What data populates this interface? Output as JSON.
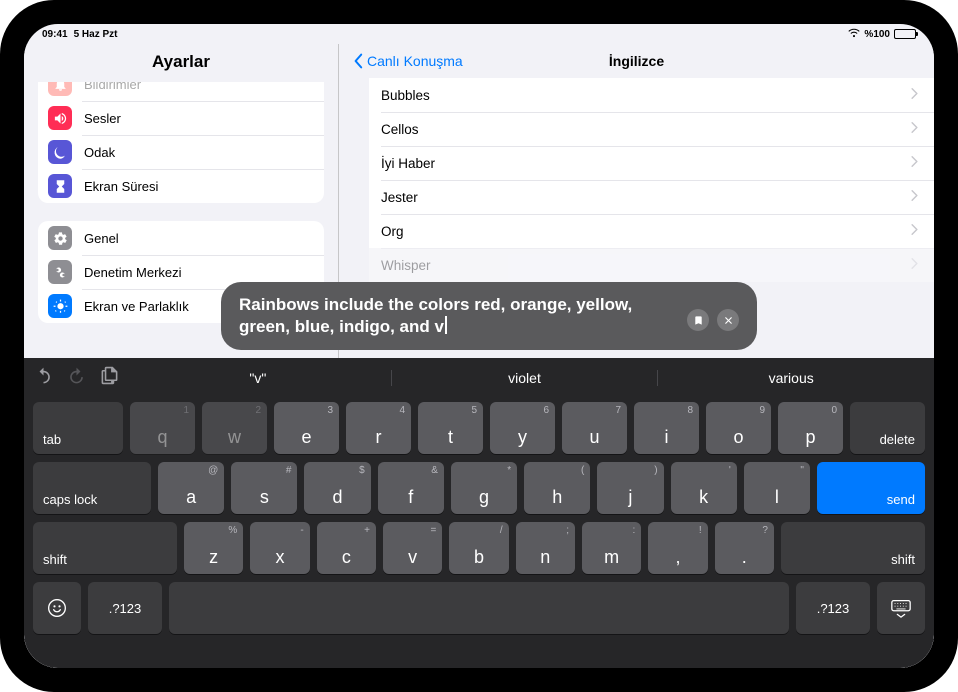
{
  "status": {
    "time": "09:41",
    "date": "5 Haz Pzt",
    "battery": "%100"
  },
  "sidebar": {
    "title": "Ayarlar",
    "group1": [
      {
        "label": "Bildirimler",
        "icon": "bell",
        "color": "#ff3b30"
      },
      {
        "label": "Sesler",
        "icon": "speaker",
        "color": "#ff2d55"
      },
      {
        "label": "Odak",
        "icon": "moon",
        "color": "#5856d6"
      },
      {
        "label": "Ekran Süresi",
        "icon": "hourglass",
        "color": "#5856d6"
      }
    ],
    "group2": [
      {
        "label": "Genel",
        "icon": "gear",
        "color": "#8e8e93"
      },
      {
        "label": "Denetim Merkezi",
        "icon": "switches",
        "color": "#8e8e93"
      },
      {
        "label": "Ekran ve Parlaklık",
        "icon": "brightness",
        "color": "#007aff"
      }
    ]
  },
  "detail": {
    "back_label": "Canlı Konuşma",
    "title": "İngilizce",
    "voices": [
      "Bubbles",
      "Cellos",
      "İyi Haber",
      "Jester",
      "Org",
      "Whisper"
    ]
  },
  "live_speech": {
    "text": "Rainbows include the colors red, orange, yellow, green, blue, indigo, and v"
  },
  "keyboard": {
    "predictions": [
      "\"v\"",
      "violet",
      "various"
    ],
    "row1": [
      {
        "k": "q",
        "s": "1"
      },
      {
        "k": "w",
        "s": "2"
      },
      {
        "k": "e",
        "s": "3"
      },
      {
        "k": "r",
        "s": "4"
      },
      {
        "k": "t",
        "s": "5"
      },
      {
        "k": "y",
        "s": "6"
      },
      {
        "k": "u",
        "s": "7"
      },
      {
        "k": "i",
        "s": "8"
      },
      {
        "k": "o",
        "s": "9"
      },
      {
        "k": "p",
        "s": "0"
      }
    ],
    "row2": [
      {
        "k": "a",
        "s": "@"
      },
      {
        "k": "s",
        "s": "#"
      },
      {
        "k": "d",
        "s": "$"
      },
      {
        "k": "f",
        "s": "&"
      },
      {
        "k": "g",
        "s": "*"
      },
      {
        "k": "h",
        "s": "("
      },
      {
        "k": "j",
        "s": ")"
      },
      {
        "k": "k",
        "s": "'"
      },
      {
        "k": "l",
        "s": "\""
      }
    ],
    "row3": [
      {
        "k": "z",
        "s": "%"
      },
      {
        "k": "x",
        "s": "-"
      },
      {
        "k": "c",
        "s": "+"
      },
      {
        "k": "v",
        "s": "="
      },
      {
        "k": "b",
        "s": "/"
      },
      {
        "k": "n",
        "s": ";"
      },
      {
        "k": "m",
        "s": ":"
      },
      {
        "k": ",",
        "s": "!"
      },
      {
        "k": ".",
        "s": "?"
      }
    ],
    "tab": "tab",
    "delete": "delete",
    "caps": "caps lock",
    "send": "send",
    "shift": "shift",
    "sym": ".?123"
  }
}
